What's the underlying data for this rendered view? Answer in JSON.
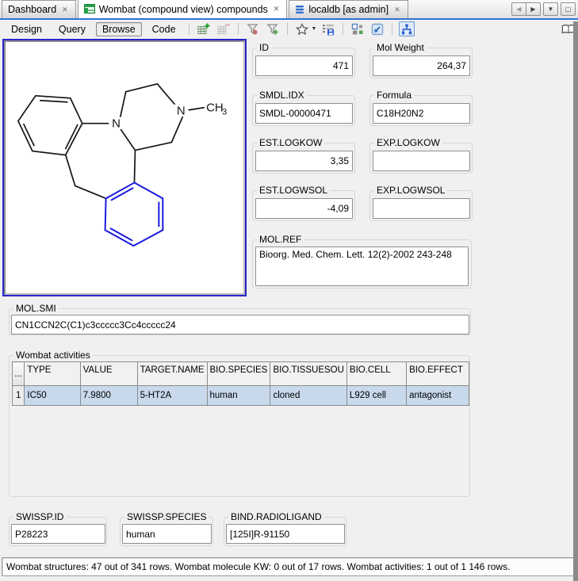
{
  "tabs": [
    {
      "label": "Dashboard",
      "active": false
    },
    {
      "label": "Wombat (compound view) compounds",
      "icon": "grid-view-green-icon",
      "active": true
    },
    {
      "label": "localdb [as admin]",
      "icon": "database-blue-icon",
      "active": false
    }
  ],
  "glyphs": {
    "close": "✕",
    "nav_prev": "◀",
    "nav_next": "▶",
    "nav_down": "▼",
    "nav_max": "▢",
    "dropdown": "▼",
    "dots": "..."
  },
  "toolbar": {
    "design": "Design",
    "query": "Query",
    "browse": "Browse",
    "code": "Code",
    "icons": [
      "add-row-icon",
      "remove-row-icon",
      "filter-result-icon",
      "filter-add-icon",
      "favorites-icon",
      "save-list-icon",
      "widgets-icon",
      "resize-icon",
      "hierarchy-icon",
      "book-icon"
    ]
  },
  "form": {
    "id": {
      "label": "ID",
      "value": "471"
    },
    "mol_weight": {
      "label": "Mol Weight",
      "value": "264,37"
    },
    "smdl_idx": {
      "label": "SMDL.IDX",
      "value": "SMDL-00000471"
    },
    "formula": {
      "label": "Formula",
      "value": "C18H20N2"
    },
    "est_logkow": {
      "label": "EST.LOGKOW",
      "value": "3,35"
    },
    "exp_logkow": {
      "label": "EXP.LOGKOW",
      "value": ""
    },
    "est_logwsol": {
      "label": "EST.LOGWSOL",
      "value": "-4,09"
    },
    "exp_logwsol": {
      "label": "EXP.LOGWSOL",
      "value": ""
    },
    "mol_ref": {
      "label": "MOL.REF",
      "value": "Bioorg. Med. Chem. Lett. 12(2)-2002 243-248"
    },
    "mol_smi": {
      "label": "MOL.SMI",
      "value": "CN1CCN2C(C1)c3ccccc3Cc4ccccc24"
    },
    "swissp_id": {
      "label": "SWISSP.ID",
      "value": "P28223"
    },
    "swissp_species": {
      "label": "SWISSP.SPECIES",
      "value": "human"
    },
    "bind_radioligand": {
      "label": "BIND.RADIOLIGAND",
      "value": "[125I]R-91150"
    }
  },
  "activities": {
    "label": "Wombat activities",
    "columns": [
      "TYPE",
      "VALUE",
      "TARGET.NAME",
      "BIO.SPECIES",
      "BIO.TISSUESOU",
      "BIO.CELL",
      "BIO.EFFECT"
    ],
    "rows": [
      {
        "num": "1",
        "cells": [
          "IC50",
          "7.9800",
          "5-HT2A",
          "human",
          "cloned",
          "L929 cell",
          "antagonist"
        ]
      }
    ]
  },
  "molecule": {
    "atom_n1": "N",
    "atom_n2": "N",
    "methyl_ch": "CH",
    "methyl_sub": "3"
  },
  "status": {
    "text": "Wombat structures: 47 out of 341 rows. Wombat molecule KW: 0 out of 17 rows. Wombat activities: 1 out of 1 146 rows."
  },
  "colors": {
    "accent_blue": "#3173d4",
    "focus_border": "#2626cc",
    "molecule_highlight": "#1a1ae0",
    "selected_row": "#c8d9ec"
  }
}
